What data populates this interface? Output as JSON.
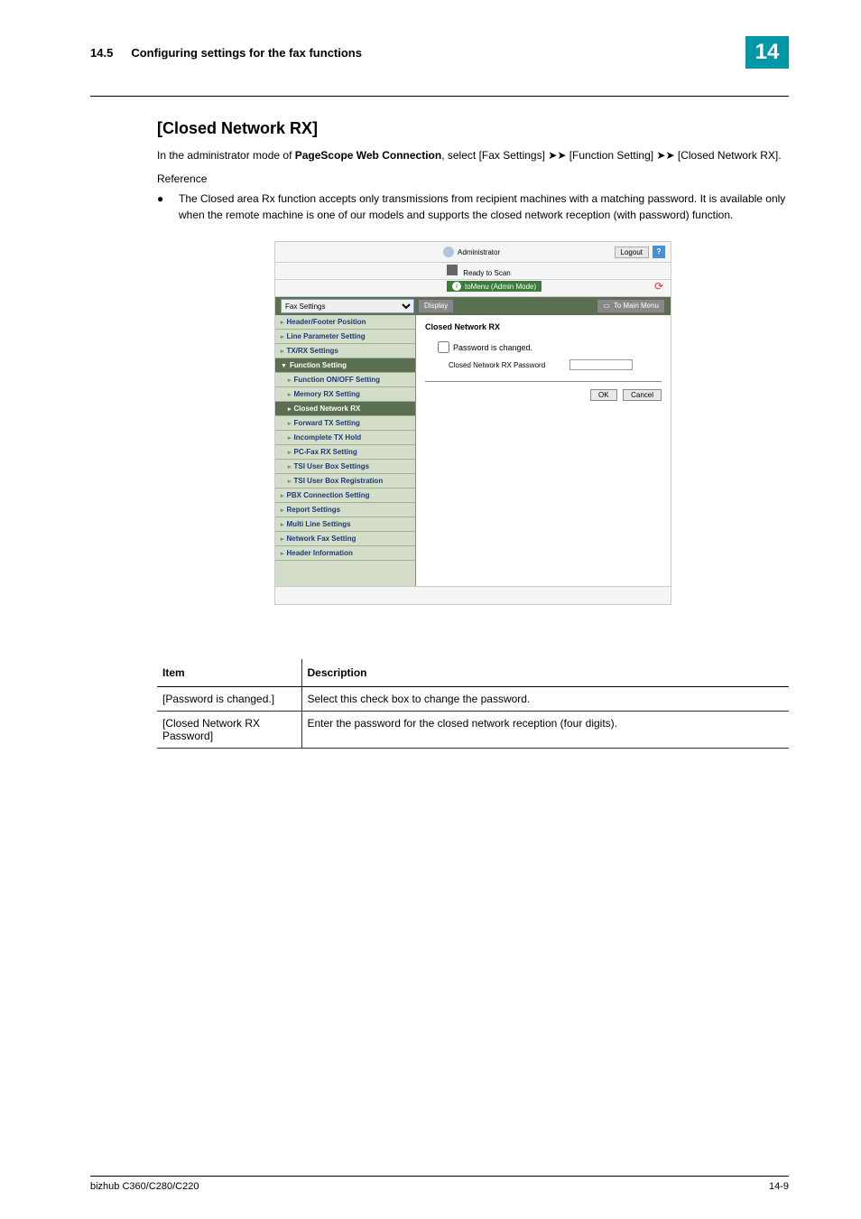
{
  "header": {
    "section_number": "14.5",
    "section_title": "Configuring settings for the fax functions",
    "chapter_number": "14"
  },
  "content": {
    "h2": "[Closed Network RX]",
    "intro_prefix": "In the administrator mode of ",
    "intro_bold": "PageScope Web Connection",
    "intro_suffix": ", select [Fax Settings] ➤➤ [Function Setting] ➤➤ [Closed Network RX].",
    "reference_label": "Reference",
    "bullet_text": "The Closed area Rx function accepts only transmissions from recipient machines with a matching password. It is available only when the remote machine is one of our models and supports the closed network reception (with password) function."
  },
  "screenshot": {
    "topbar": {
      "admin_label": "Administrator",
      "logout_label": "Logout",
      "help_icon": "?"
    },
    "status": {
      "ready_label": "Ready to Scan",
      "mode_label": "toMenu (Admin Mode)"
    },
    "toolbar": {
      "dropdown_value": "Fax Settings",
      "display_btn": "Display",
      "mainmenu_btn": "To Main Menu"
    },
    "sidebar": {
      "items": [
        {
          "label": "Header/Footer Position",
          "level": 1
        },
        {
          "label": "Line Parameter Setting",
          "level": 1
        },
        {
          "label": "TX/RX Settings",
          "level": 1
        },
        {
          "label": "Function Setting",
          "level": 1,
          "expanded": true
        },
        {
          "label": "Function ON/OFF Setting",
          "level": 2
        },
        {
          "label": "Memory RX Setting",
          "level": 2
        },
        {
          "label": "Closed Network RX",
          "level": 2,
          "active": true
        },
        {
          "label": "Forward TX Setting",
          "level": 2
        },
        {
          "label": "Incomplete TX Hold",
          "level": 2
        },
        {
          "label": "PC-Fax RX Setting",
          "level": 2
        },
        {
          "label": "TSI User Box Settings",
          "level": 2
        },
        {
          "label": "TSI User Box Registration",
          "level": 2
        },
        {
          "label": "PBX Connection Setting",
          "level": 1
        },
        {
          "label": "Report Settings",
          "level": 1
        },
        {
          "label": "Multi Line Settings",
          "level": 1
        },
        {
          "label": "Network Fax Setting",
          "level": 1
        },
        {
          "label": "Header Information",
          "level": 1
        }
      ]
    },
    "main": {
      "title": "Closed Network RX",
      "checkbox_label": "Password is changed.",
      "password_label": "Closed Network RX Password",
      "ok_btn": "OK",
      "cancel_btn": "Cancel"
    }
  },
  "table": {
    "header_item": "Item",
    "header_desc": "Description",
    "rows": [
      {
        "item": "[Password is changed.]",
        "desc": "Select this check box to change the password."
      },
      {
        "item": "[Closed Network RX Password]",
        "desc": "Enter the password for the closed network reception (four digits)."
      }
    ]
  },
  "footer": {
    "left": "bizhub C360/C280/C220",
    "right": "14-9"
  }
}
